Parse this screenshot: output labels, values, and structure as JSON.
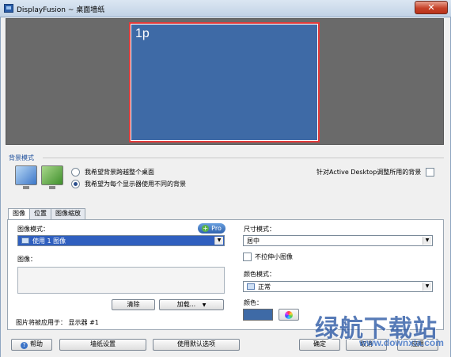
{
  "window": {
    "title": "DisplayFusion ~ 桌面墙纸",
    "close_glyph": "✕"
  },
  "preview": {
    "monitor_label": "1p"
  },
  "background_mode": {
    "group_title": "背景模式",
    "option_span": "我希望背景跨越整个桌面",
    "option_per_monitor": "我希望为每个显示器使用不同的背景",
    "selected": "per_monitor",
    "active_desktop_label": "针对Active Desktop调整所用的背景",
    "active_desktop_checked": false
  },
  "tabs": [
    {
      "label": "图像",
      "active": true
    },
    {
      "label": "位置",
      "active": false
    },
    {
      "label": "图像缩放",
      "active": false
    }
  ],
  "image_tab": {
    "image_mode_label": "图像模式：",
    "pro_label": "Pro",
    "image_mode_value": "使用 1 图像",
    "image_label": "图像：",
    "clear_button": "清除",
    "load_button": "加载...",
    "applied_text": "图片将被应用于：  显示器 #1",
    "size_mode_label": "尺寸模式：",
    "size_mode_value": "居中",
    "no_stretch_label": "不拉伸小图像",
    "no_stretch_checked": false,
    "color_mode_label": "颜色模式：",
    "color_mode_value": "正常",
    "color_label": "颜色：",
    "color_value": "#3e6aa6"
  },
  "footer": {
    "help_button": "帮助",
    "wallpaper_settings_button": "墙纸设置",
    "use_defaults_button": "使用默认选项",
    "ok_button": "确定",
    "cancel_button": "取消",
    "apply_button": "应用"
  },
  "watermark": {
    "text": "绿航下载站",
    "url": "www.downxia.com"
  }
}
